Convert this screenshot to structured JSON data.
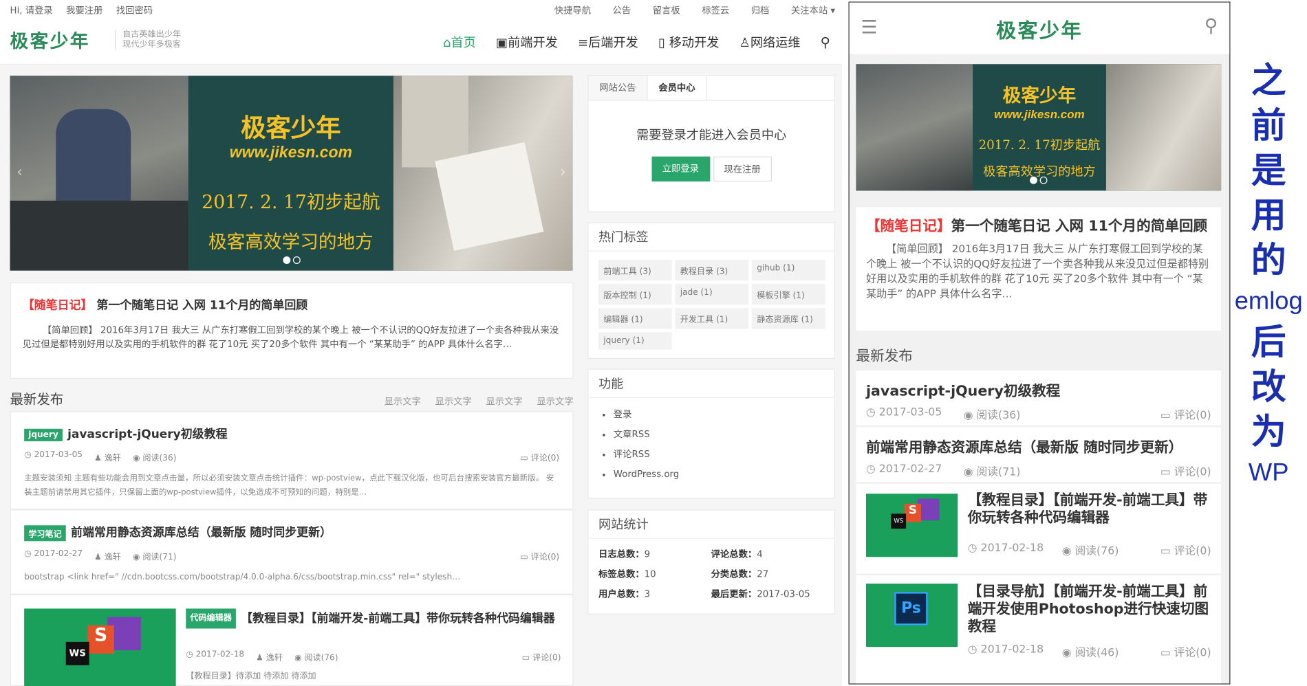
{
  "topbar": {
    "left": [
      "Hi, 请登录",
      "我要注册",
      "找回密码"
    ],
    "right": [
      "快捷导航",
      "公告",
      "留言板",
      "标签云",
      "归档",
      "关注本站 ▾"
    ]
  },
  "brand": {
    "logo": "极客少年",
    "slogan_1": "自古英雄出少年",
    "slogan_2": "现代少年多极客"
  },
  "nav": {
    "items": [
      "首页",
      "前端开发",
      "后端开发",
      "移动开发",
      "网络运维"
    ]
  },
  "banner": {
    "title": "极客少年",
    "url": "www.jikesn.com",
    "line1": "2017. 2. 17初步起航",
    "line2": "极客高效学习的地方"
  },
  "featured": {
    "category": "【随笔日记】",
    "title": "第一个随笔日记 入网 11个月的简单回顾",
    "excerpt": "【简单回顾】 2016年3月17日 我大三 从广东打寒假工回到学校的某个晚上 被一个不认识的QQ好友拉进了一个卖各种我从来没见过但是都特别好用以及实用的手机软件的群 花了10元 买了20多个软件 其中有一个 “某某助手” 的APP 具体什么名字…",
    "mobile_excerpt": "【简单回顾】 2016年3月17日 我大三 从广东打寒假工回到学校的某个晚上 被一个不认识的QQ好友拉进了一个卖各种我从来没见过但是都特别好用以及实用的手机软件的群 花了10元 买了20多个软件 其中有一个 “某某助手” 的APP 具体什么名字…"
  },
  "latest": {
    "heading": "最新发布",
    "filters": [
      "显示文字",
      "显示文字",
      "显示文字",
      "显示文字"
    ],
    "posts": [
      {
        "tag": "jquery",
        "title": "javascript-jQuery初级教程",
        "date": "2017-03-05",
        "author": "逸轩",
        "reads": "阅读(36)",
        "comments": "评论(0)",
        "excerpt": "主题安装须知 主题有些功能会用到文章点击量，所以必须安装文章点击统计插件：wp-postview，点此下载汉化版，也可后台搜索安装官方最新版。 安装主题前请禁用其它插件，只保留上面的wp-postview插件，以免造成不可预知的问题，特别是…"
      },
      {
        "tag": "学习笔记",
        "title": "前端常用静态资源库总结（最新版 随时同步更新）",
        "date": "2017-02-27",
        "author": "逸轩",
        "reads": "阅读(71)",
        "comments": "评论(0)",
        "excerpt": "bootstrap <link href=\" //cdn.bootcss.com/bootstrap/4.0.0-alpha.6/css/bootstrap.min.css\" rel=\" stylesh…"
      },
      {
        "tag": "代码编辑器",
        "title": "【教程目录】【前端开发-前端工具】带你玩转各种代码编辑器",
        "date": "2017-02-18",
        "author": "逸轩",
        "reads": "阅读(76)",
        "comments": "评论(0)",
        "excerpt": "【教程目录】待添加 待添加 待添加"
      }
    ]
  },
  "sidebar": {
    "tabs": [
      "网站公告",
      "会员中心"
    ],
    "login_msg": "需要登录才能进入会员中心",
    "login_btn": "立即登录",
    "register_btn": "现在注册",
    "hot_tags_title": "热门标签",
    "tags": [
      "前端工具 (3)",
      "教程目录 (3)",
      "gihub (1)",
      "版本控制 (1)",
      "jade (1)",
      "模板引擎 (1)",
      "编辑器 (1)",
      "开发工具 (1)",
      "静态资源库 (1)",
      "jquery (1)"
    ],
    "functions_title": "功能",
    "functions": [
      "登录",
      "文章RSS",
      "评论RSS",
      "WordPress.org"
    ],
    "stats_title": "网站统计",
    "stats": [
      {
        "k": "日志总数：",
        "v": "9"
      },
      {
        "k": "评论总数：",
        "v": "4"
      },
      {
        "k": "标签总数：",
        "v": "10"
      },
      {
        "k": "分类总数：",
        "v": "27"
      },
      {
        "k": "用户总数：",
        "v": "3"
      },
      {
        "k": "最后更新：",
        "v": "2017-03-05"
      }
    ]
  },
  "mobile": {
    "logo": "极客少年",
    "latest_heading": "最新发布",
    "posts": [
      {
        "title": "javascript-jQuery初级教程",
        "date": "2017-03-05",
        "reads": "阅读(36)",
        "comments": "评论(0)"
      },
      {
        "title": "前端常用静态资源库总结（最新版 随时同步更新）",
        "date": "2017-02-27",
        "reads": "阅读(71)",
        "comments": "评论(0)"
      },
      {
        "title": "【教程目录】【前端开发-前端工具】带你玩转各种代码编辑器",
        "date": "2017-02-18",
        "reads": "阅读(76)",
        "comments": "评论(0)"
      },
      {
        "title": "【目录导航】【前端开发-前端工具】前端开发使用Photoshop进行快速切图教程",
        "date": "2017-02-18",
        "reads": "阅读(46)",
        "comments": "评论(0)"
      }
    ]
  },
  "caption": {
    "chars": [
      "之",
      "前",
      "是",
      "用",
      "的"
    ],
    "emlog": "emlog",
    "chars2": [
      "后",
      "改",
      "为"
    ],
    "wp": "WP"
  },
  "colors": {
    "accent": "#2aa56b",
    "red": "#e33333",
    "caption": "#1a2eb0"
  }
}
